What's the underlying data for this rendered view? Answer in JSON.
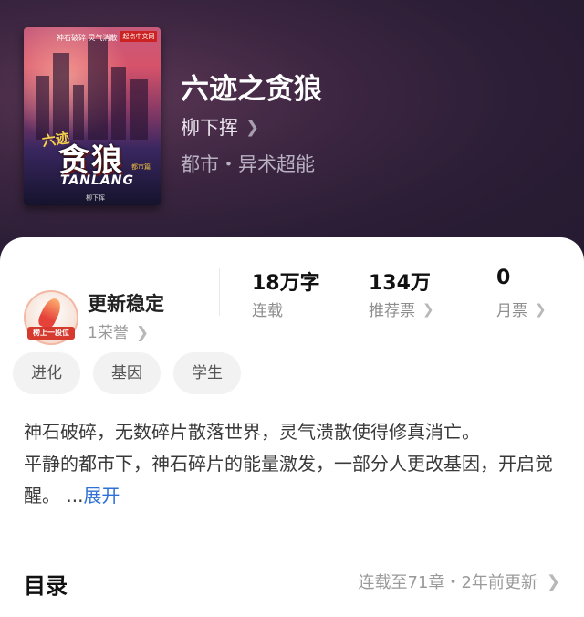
{
  "book": {
    "title": "六迹之贪狼",
    "author": "柳下挥",
    "genre": "都市・异术超能",
    "cover": {
      "top_text": "神石破碎 灵气消散",
      "publisher": "起点中文网",
      "small_title": "六迹",
      "big_title": "贪狼",
      "english": "TANLANG",
      "tag": "都市篇",
      "author_small": "柳下挥"
    }
  },
  "honor": {
    "status": "更新稳定",
    "count_label": "1荣誉",
    "badge_text": "榜上一段位"
  },
  "stats": [
    {
      "value": "18万字",
      "label": "连载"
    },
    {
      "value": "134万",
      "label": "推荐票"
    },
    {
      "value": "0",
      "label": "月票"
    }
  ],
  "tags": [
    "进化",
    "基因",
    "学生"
  ],
  "description": {
    "line1": "神石破碎，无数碎片散落世界，灵气溃散使得修真消亡。",
    "line2": "平静的都市下，神石碎片的能量激发，一部分人更改基因，开启觉醒。",
    "ellipsis": " ...",
    "more_label": "展开"
  },
  "toc": {
    "title": "目录",
    "info": "连载至71章・2年前更新"
  },
  "icons": {
    "chevron": "chevron-right-icon"
  },
  "colors": {
    "accent_link": "#2f6fd6",
    "hero_bg": "#2a1d35"
  }
}
